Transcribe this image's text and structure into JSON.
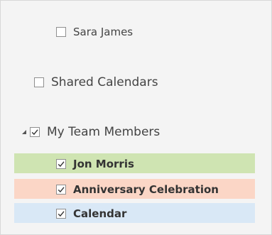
{
  "colors": {
    "frame_bg": "#f4f4f4",
    "jon_morris_band": "#cfe4b2",
    "anniversary_band": "#fbd6c6",
    "calendar_band": "#d9e8f6",
    "checkbox_border": "#8f8f8f",
    "checkmark": "#333333"
  },
  "items": {
    "sara_james": {
      "label": "Sara James",
      "checked": false
    },
    "shared_calendars": {
      "label": "Shared Calendars",
      "checked": false
    },
    "my_team_members": {
      "label": "My Team Members",
      "checked": true,
      "expanded": true
    },
    "team": [
      {
        "label": "Jon Morris",
        "checked": true
      },
      {
        "label": "Anniversary Celebration",
        "checked": true
      },
      {
        "label": "Calendar",
        "checked": true
      }
    ]
  },
  "icons": {
    "expand": "expand-triangle-icon",
    "check": "checkmark-icon"
  }
}
